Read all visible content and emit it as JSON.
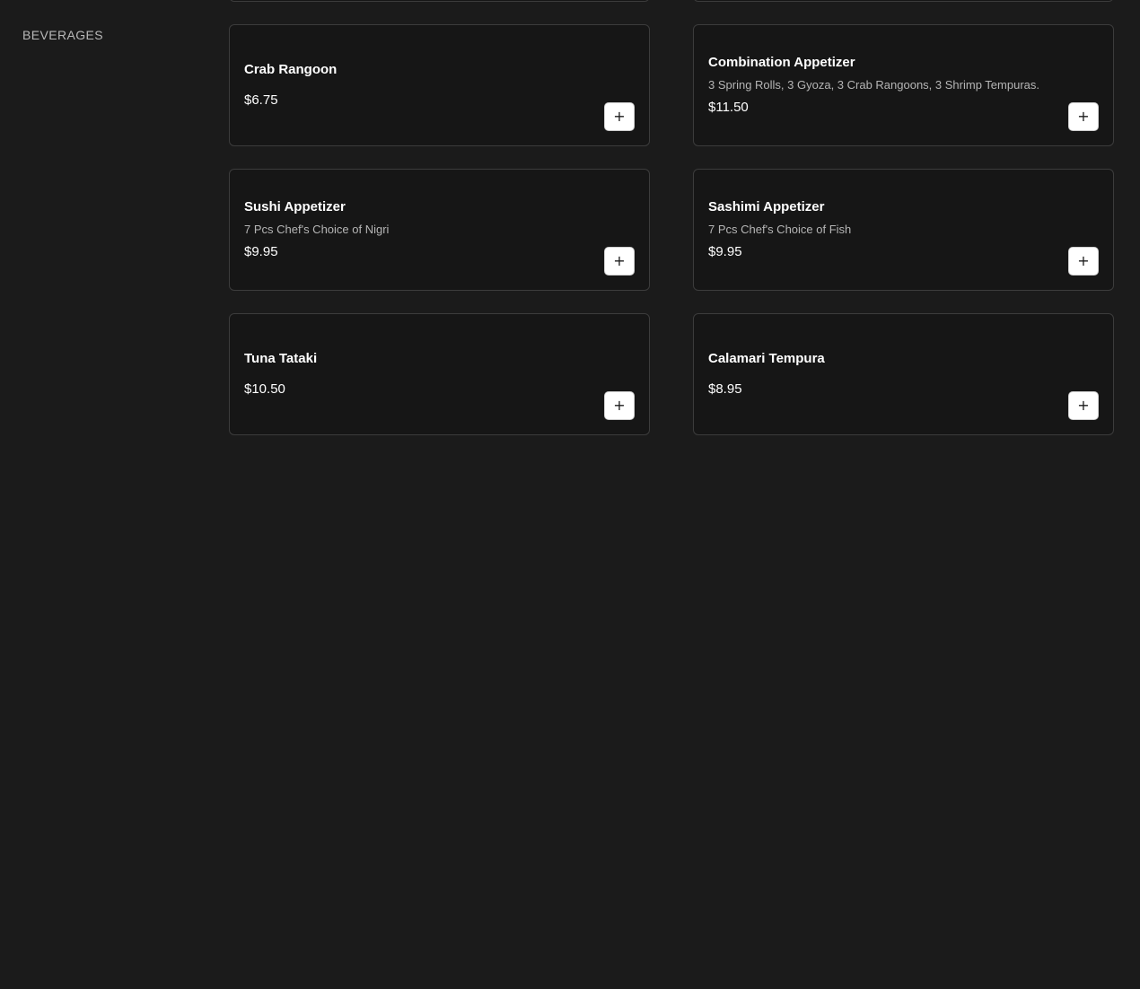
{
  "sidebar": {
    "items": [
      {
        "label": "BEVERAGES"
      }
    ]
  },
  "menu": {
    "items": [
      {
        "name": "Crab Rangoon",
        "description": "",
        "price": "$6.75"
      },
      {
        "name": "Combination Appetizer",
        "description": "3 Spring Rolls, 3 Gyoza, 3 Crab Rangoons, 3 Shrimp Tempuras.",
        "price": "$11.50"
      },
      {
        "name": "Sushi Appetizer",
        "description": "7 Pcs Chef's Choice of Nigri",
        "price": "$9.95"
      },
      {
        "name": "Sashimi Appetizer",
        "description": "7 Pcs Chef's Choice of Fish",
        "price": "$9.95"
      },
      {
        "name": "Tuna Tataki",
        "description": "",
        "price": "$10.50"
      },
      {
        "name": "Calamari Tempura",
        "description": "",
        "price": "$8.95"
      }
    ],
    "add_symbol": "+"
  },
  "colors": {
    "background": "#1b1b1b",
    "card_background": "#161616",
    "card_border": "#3c3c3c",
    "text_primary": "#ffffff",
    "text_secondary": "#b5b5b5",
    "add_button_background": "#ffffff"
  }
}
